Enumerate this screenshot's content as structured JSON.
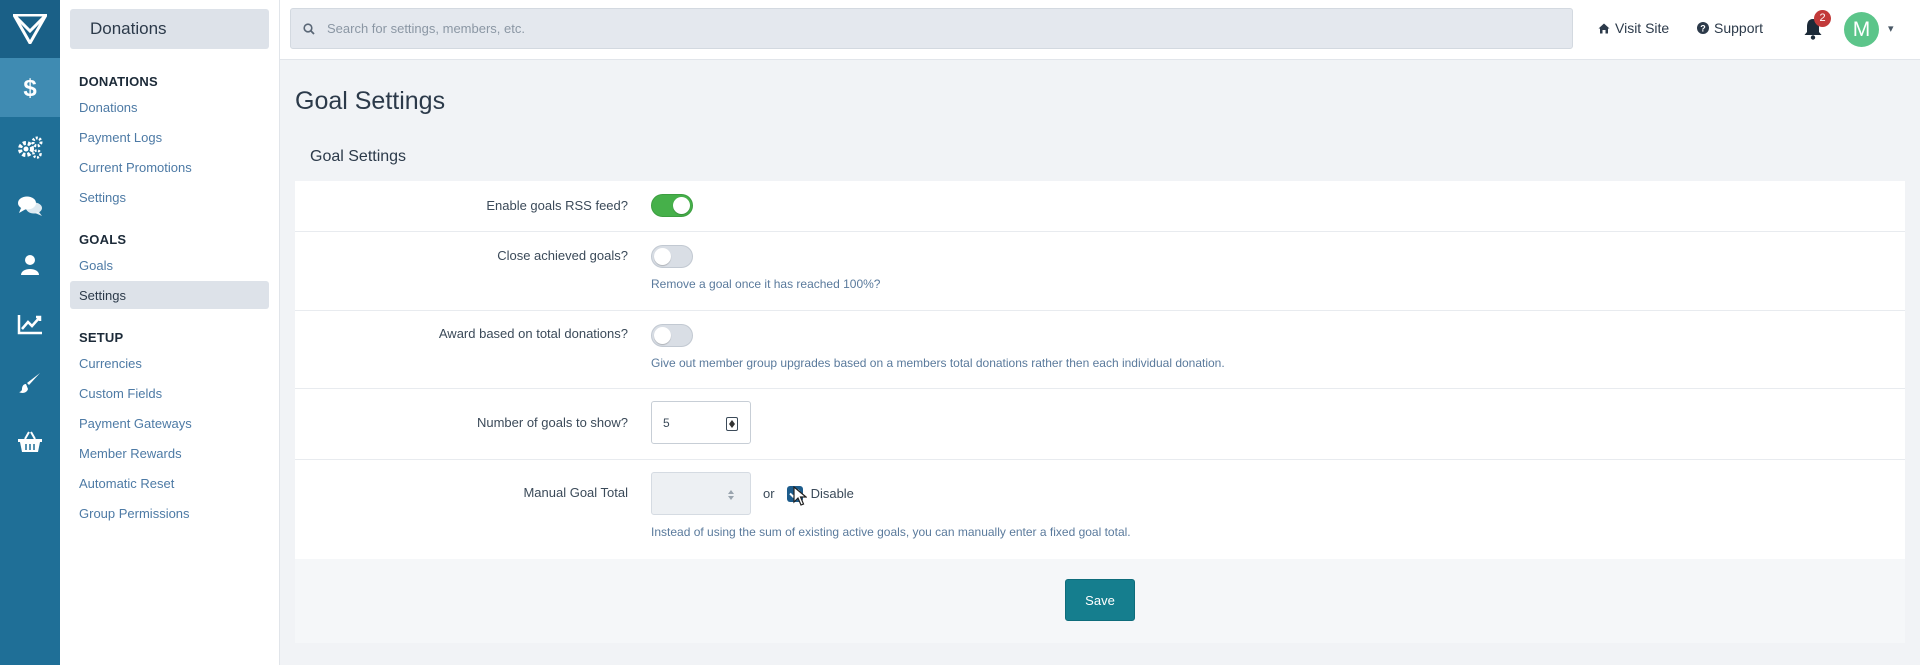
{
  "rail": {
    "items": [
      {
        "icon": "dollar-icon",
        "active": true
      },
      {
        "icon": "gears-icon",
        "active": false
      },
      {
        "icon": "comments-icon",
        "active": false
      },
      {
        "icon": "user-icon",
        "active": false
      },
      {
        "icon": "line-chart-icon",
        "active": false
      },
      {
        "icon": "paint-brush-icon",
        "active": false
      },
      {
        "icon": "basket-icon",
        "active": false
      }
    ]
  },
  "sidebar": {
    "title": "Donations",
    "groups": [
      {
        "heading": "DONATIONS",
        "links": [
          "Donations",
          "Payment Logs",
          "Current Promotions",
          "Settings"
        ]
      },
      {
        "heading": "GOALS",
        "links": [
          "Goals",
          "Settings"
        ],
        "active_index": 1
      },
      {
        "heading": "SETUP",
        "links": [
          "Currencies",
          "Custom Fields",
          "Payment Gateways",
          "Member Rewards",
          "Automatic Reset",
          "Group Permissions"
        ]
      }
    ]
  },
  "topbar": {
    "search_placeholder": "Search for settings, members, etc.",
    "visit_site": "Visit Site",
    "support": "Support",
    "notification_count": "2",
    "avatar_letter": "M"
  },
  "page": {
    "title": "Goal Settings",
    "panel_title": "Goal Settings",
    "fields": {
      "rss": {
        "label": "Enable goals RSS feed?",
        "enabled": true
      },
      "close": {
        "label": "Close achieved goals?",
        "enabled": false,
        "help": "Remove a goal once it has reached 100%?"
      },
      "award": {
        "label": "Award based on total donations?",
        "enabled": false,
        "help": "Give out member group upgrades based on a members total donations rather then each individual donation."
      },
      "number": {
        "label": "Number of goals to show?",
        "value": "5"
      },
      "manual": {
        "label": "Manual Goal Total",
        "value": "",
        "or": "or",
        "checkbox_label": "Disable",
        "checked": true,
        "help": "Instead of using the sum of existing active goals, you can manually enter a fixed goal total."
      }
    },
    "save_label": "Save"
  },
  "colors": {
    "rail": "#1f6f97",
    "toggle_on": "#46b04a",
    "save_button": "#157e8e",
    "badge": "#c23a3a",
    "avatar": "#5cc58a"
  }
}
